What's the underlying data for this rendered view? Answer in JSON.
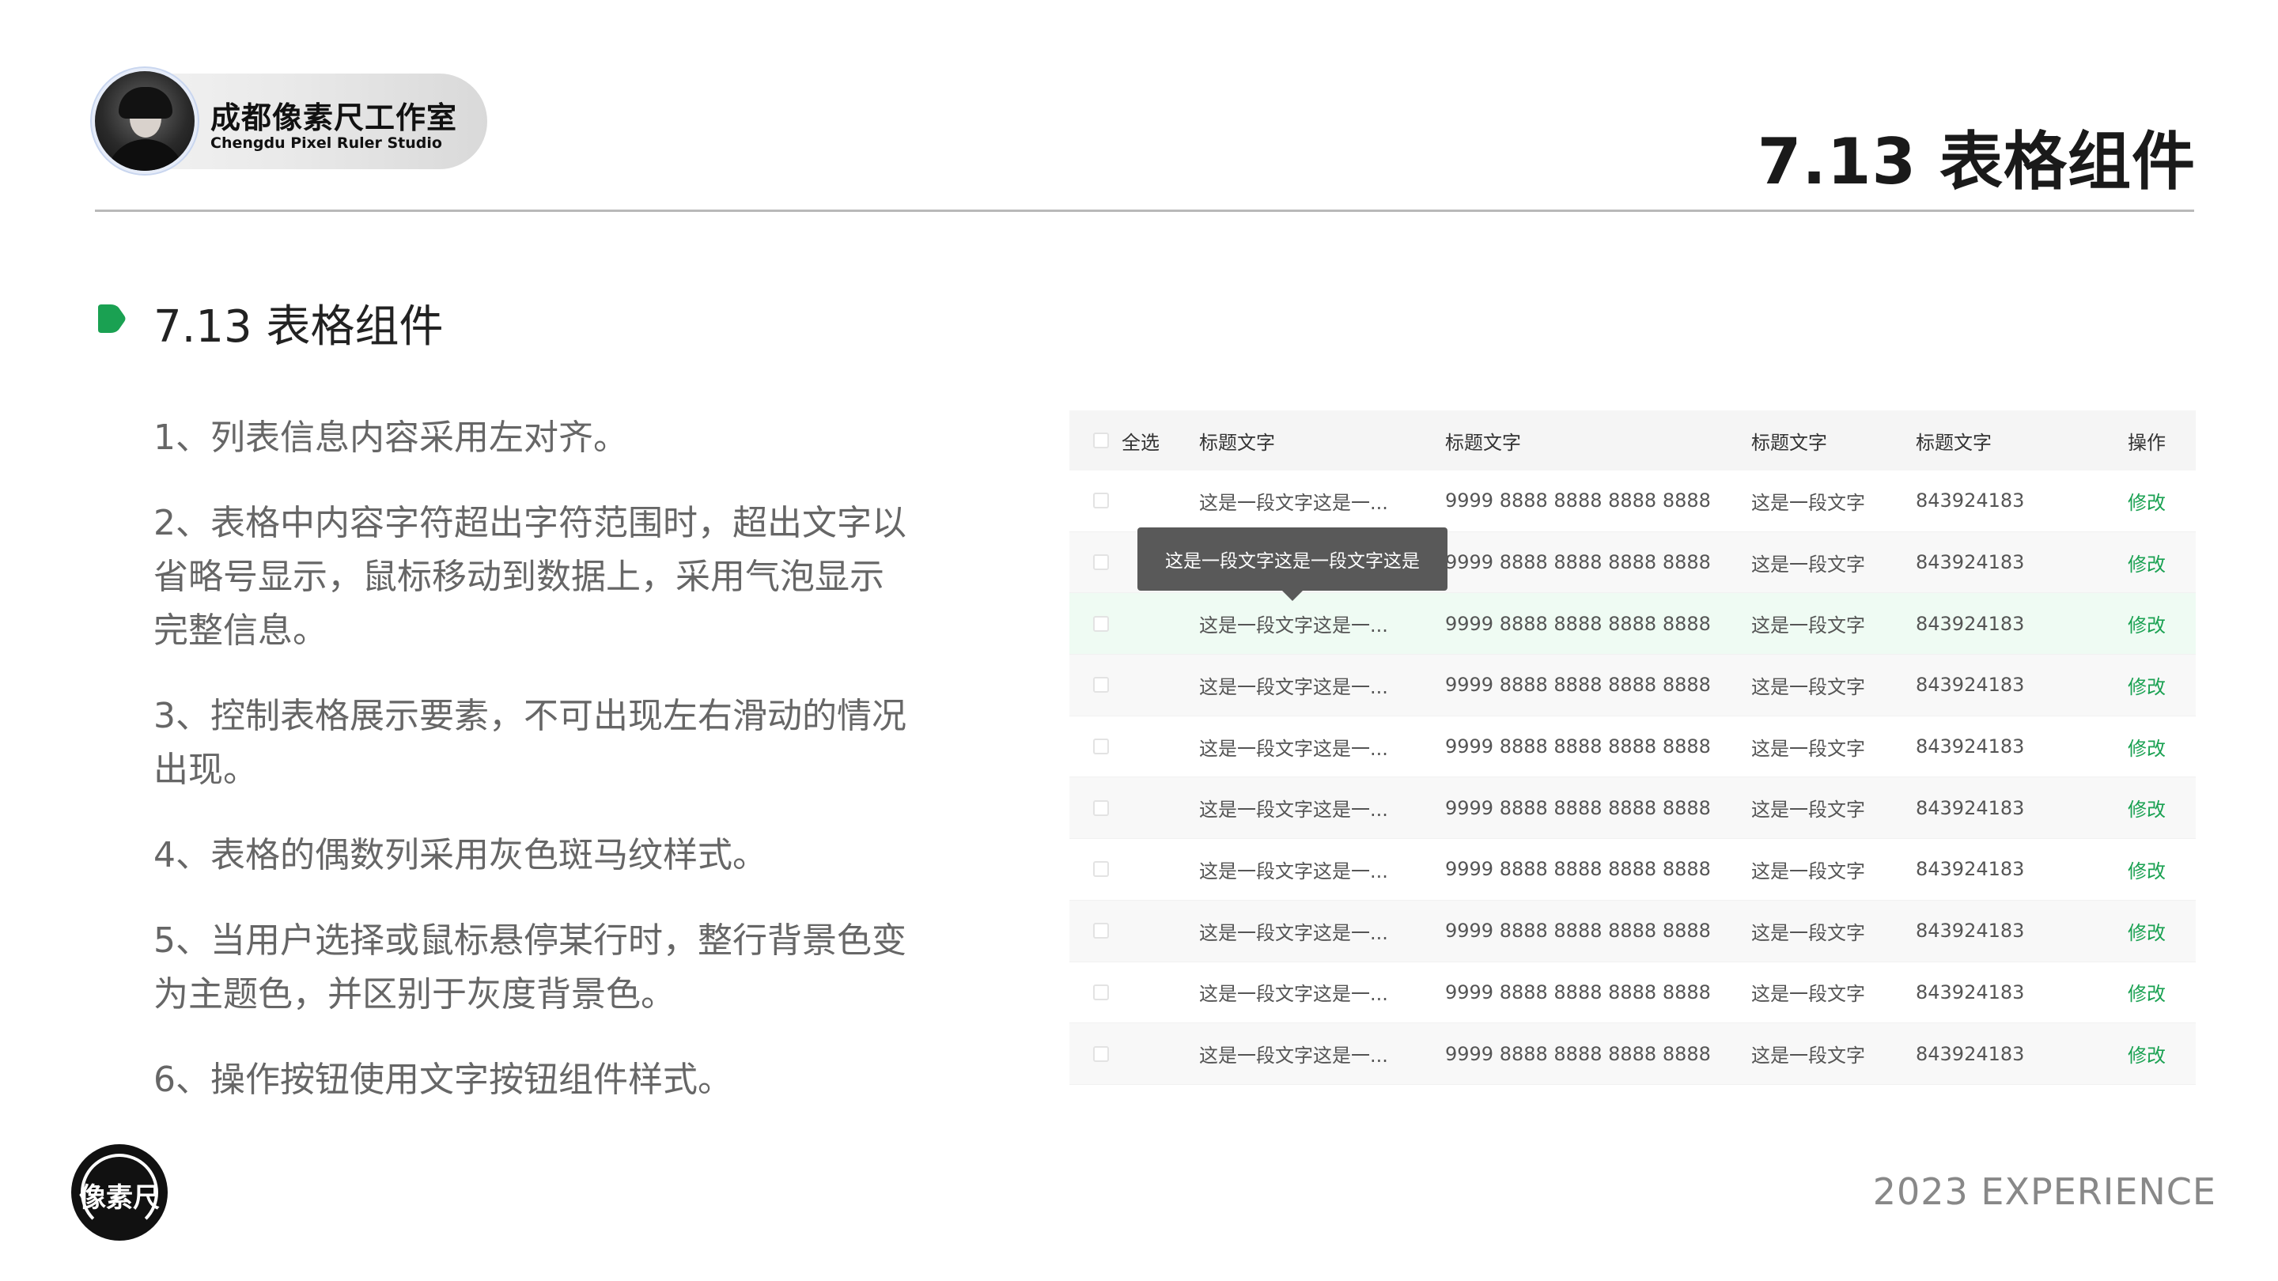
{
  "header": {
    "studio_name": "成都像素尺工作室",
    "studio_name_en": "Chengdu Pixel Ruler Studio",
    "page_title": "7.13 表格组件"
  },
  "section": {
    "title": "7.13 表格组件",
    "bullet_color": "#1aa152"
  },
  "rules": [
    "1、列表信息内容采用左对齐。",
    "2、表格中内容字符超出字符范围时，超出文字以省略号显示，鼠标移动到数据上，采用气泡显示完整信息。",
    "3、控制表格展示要素，不可出现左右滑动的情况出现。",
    "4、表格的偶数列采用灰色斑马纹样式。",
    "5、当用户选择或鼠标悬停某行时，整行背景色变为主题色，并区别于灰度背景色。",
    "6、操作按钮使用文字按钮组件样式。"
  ],
  "table": {
    "select_all_label": "全选",
    "columns": [
      "标题文字",
      "标题文字",
      "标题文字",
      "标题文字",
      "操作"
    ],
    "rows": [
      {
        "c1": "这是一段文字这是一...",
        "c2": "9999 8888 8888 8888 8888",
        "c3": "这是一段文字",
        "c4": "843924183",
        "action": "修改",
        "state": "normal"
      },
      {
        "c1": "这是一段文字这是一...",
        "c2": "9999 8888 8888 8888 8888",
        "c3": "这是一段文字",
        "c4": "843924183",
        "action": "修改",
        "state": "striped"
      },
      {
        "c1": "这是一段文字这是一...",
        "c2": "9999 8888 8888 8888 8888",
        "c3": "这是一段文字",
        "c4": "843924183",
        "action": "修改",
        "state": "hovered"
      },
      {
        "c1": "这是一段文字这是一...",
        "c2": "9999 8888 8888 8888 8888",
        "c3": "这是一段文字",
        "c4": "843924183",
        "action": "修改",
        "state": "striped"
      },
      {
        "c1": "这是一段文字这是一...",
        "c2": "9999 8888 8888 8888 8888",
        "c3": "这是一段文字",
        "c4": "843924183",
        "action": "修改",
        "state": "normal"
      },
      {
        "c1": "这是一段文字这是一...",
        "c2": "9999 8888 8888 8888 8888",
        "c3": "这是一段文字",
        "c4": "843924183",
        "action": "修改",
        "state": "striped"
      },
      {
        "c1": "这是一段文字这是一...",
        "c2": "9999 8888 8888 8888 8888",
        "c3": "这是一段文字",
        "c4": "843924183",
        "action": "修改",
        "state": "normal"
      },
      {
        "c1": "这是一段文字这是一...",
        "c2": "9999 8888 8888 8888 8888",
        "c3": "这是一段文字",
        "c4": "843924183",
        "action": "修改",
        "state": "striped"
      },
      {
        "c1": "这是一段文字这是一...",
        "c2": "9999 8888 8888 8888 8888",
        "c3": "这是一段文字",
        "c4": "843924183",
        "action": "修改",
        "state": "normal"
      },
      {
        "c1": "这是一段文字这是一...",
        "c2": "9999 8888 8888 8888 8888",
        "c3": "这是一段文字",
        "c4": "843924183",
        "action": "修改",
        "state": "striped"
      }
    ],
    "tooltip_text": "这是一段文字这是一段文字这是",
    "action_color": "#1aa152",
    "hover_row_color": "#effbf3",
    "stripe_color": "#f8f8f8"
  },
  "footer": {
    "logo_text": "像素尺",
    "year_label": "2023  EXPERIENCE"
  }
}
